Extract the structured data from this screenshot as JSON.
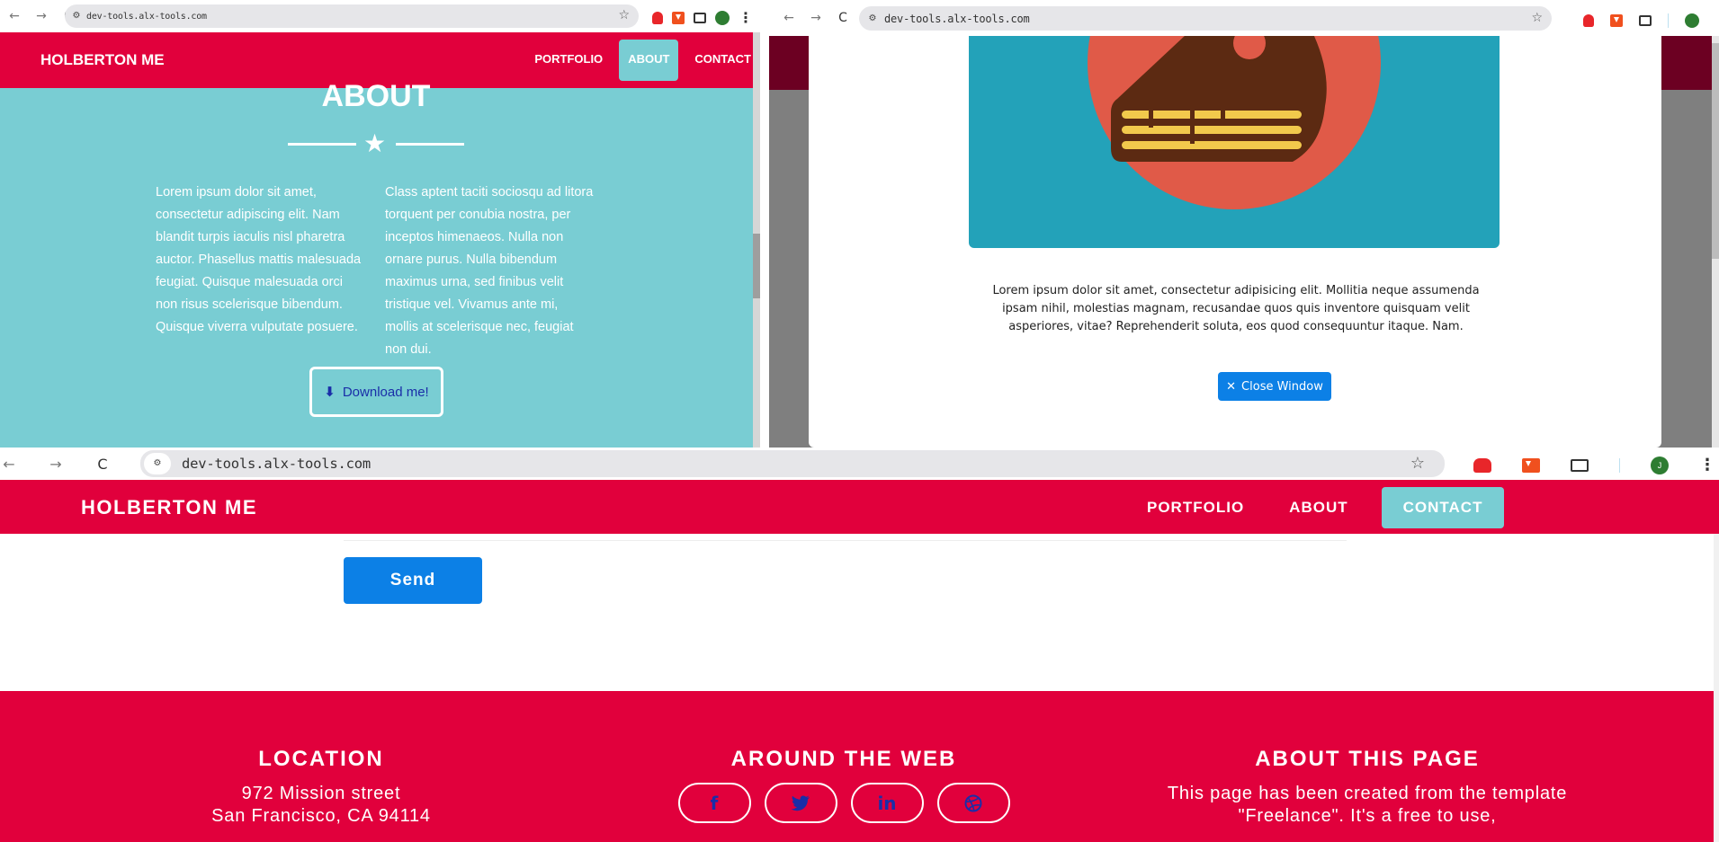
{
  "window_a": {
    "chrome": {
      "url": "dev-tools.alx-tools.com",
      "nav": {
        "back": "←",
        "forward": "→",
        "reload": "C"
      }
    },
    "nav": {
      "brand": "HOLBERTON ME",
      "links": [
        {
          "label": "PORTFOLIO",
          "active": false
        },
        {
          "label": "ABOUT",
          "active": true
        },
        {
          "label": "CONTACT",
          "active": false
        }
      ]
    },
    "about": {
      "title": "ABOUT",
      "col1": "Lorem ipsum dolor sit amet, consectetur adipiscing elit. Nam blandit turpis iaculis nisl pharetra auctor. Phasellus mattis malesuada feugiat. Quisque malesuada orci non risus scelerisque bibendum. Quisque viverra vulputate posuere.",
      "col2": "Class aptent taciti sociosqu ad litora torquent per conubia nostra, per inceptos himenaeos. Nulla non ornare purus. Nulla bibendum maximus urna, sed finibus velit tristique vel. Vivamus ante mi, mollis at scelerisque nec, feugiat non dui.",
      "download_label": "Download me!",
      "download_icon": "⬇"
    }
  },
  "window_b": {
    "chrome": {
      "url": "dev-tools.alx-tools.com",
      "nav": {
        "back": "←",
        "forward": "→",
        "reload": "C"
      }
    },
    "modal": {
      "text": "Lorem ipsum dolor sit amet, consectetur adipisicing elit. Mollitia neque assumenda ipsam nihil, molestias magnam, recusandae quos quis inventore quisquam velit asperiores, vitae? Reprehenderit soluta, eos quod consequuntur itaque. Nam.",
      "close_label": "Close Window",
      "close_icon": "✕"
    }
  },
  "window_c": {
    "chrome": {
      "url": "dev-tools.alx-tools.com",
      "nav": {
        "back": "←",
        "forward": "→",
        "reload": "C"
      },
      "profile": "J"
    },
    "nav": {
      "brand": "HOLBERTON ME",
      "links": [
        {
          "label": "PORTFOLIO",
          "active": false
        },
        {
          "label": "ABOUT",
          "active": false
        },
        {
          "label": "CONTACT",
          "active": true
        }
      ]
    },
    "form": {
      "send_label": "Send"
    },
    "footer": {
      "location": {
        "title": "LOCATION",
        "line1": "972 Mission street",
        "line2": "San Francisco, CA 94114"
      },
      "web": {
        "title": "AROUND THE WEB",
        "socials": [
          {
            "icon": "facebook-icon",
            "glyph": "f"
          },
          {
            "icon": "twitter-icon",
            "glyph": "🐦"
          },
          {
            "icon": "linkedin-icon",
            "glyph": "in"
          },
          {
            "icon": "dribbble-icon",
            "glyph": "◎"
          }
        ]
      },
      "about": {
        "title": "ABOUT THIS PAGE",
        "text": "This page has been created from the template \"Freelance\". It's a free to use,"
      }
    }
  },
  "colors": {
    "brand_red": "#e1003c",
    "teal": "#79cdd3",
    "button_blue": "#0c80e6",
    "link_blue": "#1a2ea8"
  }
}
